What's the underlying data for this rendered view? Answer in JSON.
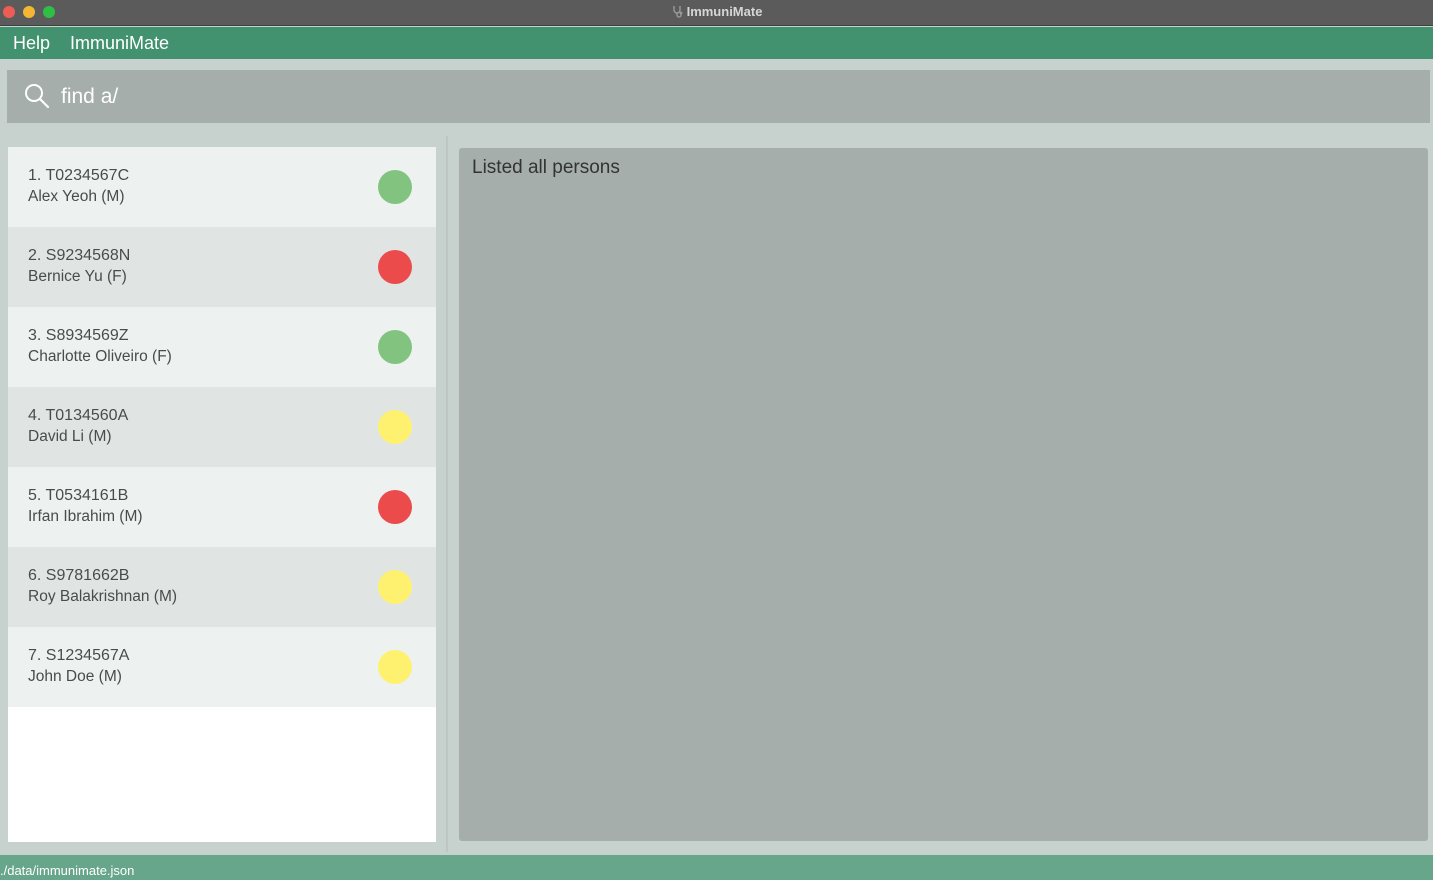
{
  "window": {
    "title": "ImmuniMate"
  },
  "menu": {
    "items": [
      "Help",
      "ImmuniMate"
    ]
  },
  "command_box": {
    "value": "find a/"
  },
  "persons": [
    {
      "index": "1.",
      "nric": "T0234567C",
      "name": "Alex Yeoh (M)",
      "status_color": "#82c37f"
    },
    {
      "index": "2.",
      "nric": "S9234568N",
      "name": "Bernice Yu (F)",
      "status_color": "#ec4b4b"
    },
    {
      "index": "3.",
      "nric": "S8934569Z",
      "name": "Charlotte Oliveiro (F)",
      "status_color": "#82c37f"
    },
    {
      "index": "4.",
      "nric": "T0134560A",
      "name": "David Li (M)",
      "status_color": "#fdf16f"
    },
    {
      "index": "5.",
      "nric": "T0534161B",
      "name": "Irfan Ibrahim (M)",
      "status_color": "#ec4b4b"
    },
    {
      "index": "6.",
      "nric": "S9781662B",
      "name": "Roy Balakrishnan (M)",
      "status_color": "#fdf16f"
    },
    {
      "index": "7.",
      "nric": "S1234567A",
      "name": "John Doe (M)",
      "status_color": "#fdf16f"
    }
  ],
  "result": {
    "message": "Listed all persons"
  },
  "statusbar": {
    "path": "./data/immunimate.json"
  },
  "colors": {
    "menubar": "#42916f",
    "statusbar": "#67a68a",
    "panel": "#a6aeab"
  }
}
